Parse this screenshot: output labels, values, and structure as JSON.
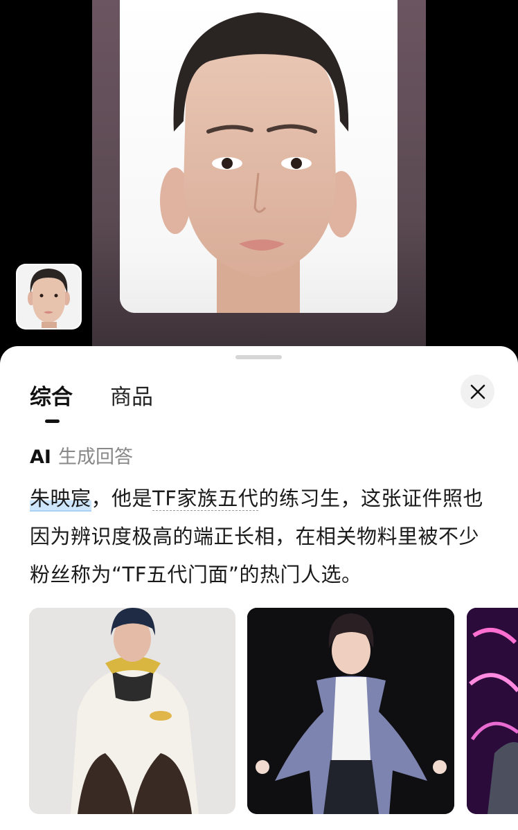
{
  "sheet": {
    "tabs": [
      {
        "label": "综合",
        "active": true
      },
      {
        "label": "商品",
        "active": false
      }
    ],
    "close_icon": "close-icon",
    "ai_label": {
      "prefix": "AI",
      "suffix": "生成回答"
    },
    "answer": {
      "highlight": "朱映宸",
      "part1": "，他是",
      "dotted": "TF家族五代",
      "part2": "的练习生，这张证件照也因为辨识度极高的端正长相，在相关物料里被不少粉丝称为“TF五代门面”的热门人选。"
    },
    "gallery_count": 3
  },
  "colors": {
    "highlight": "#cde6fb",
    "sheet_bg": "#ffffff",
    "photo_bg": "#000000"
  }
}
